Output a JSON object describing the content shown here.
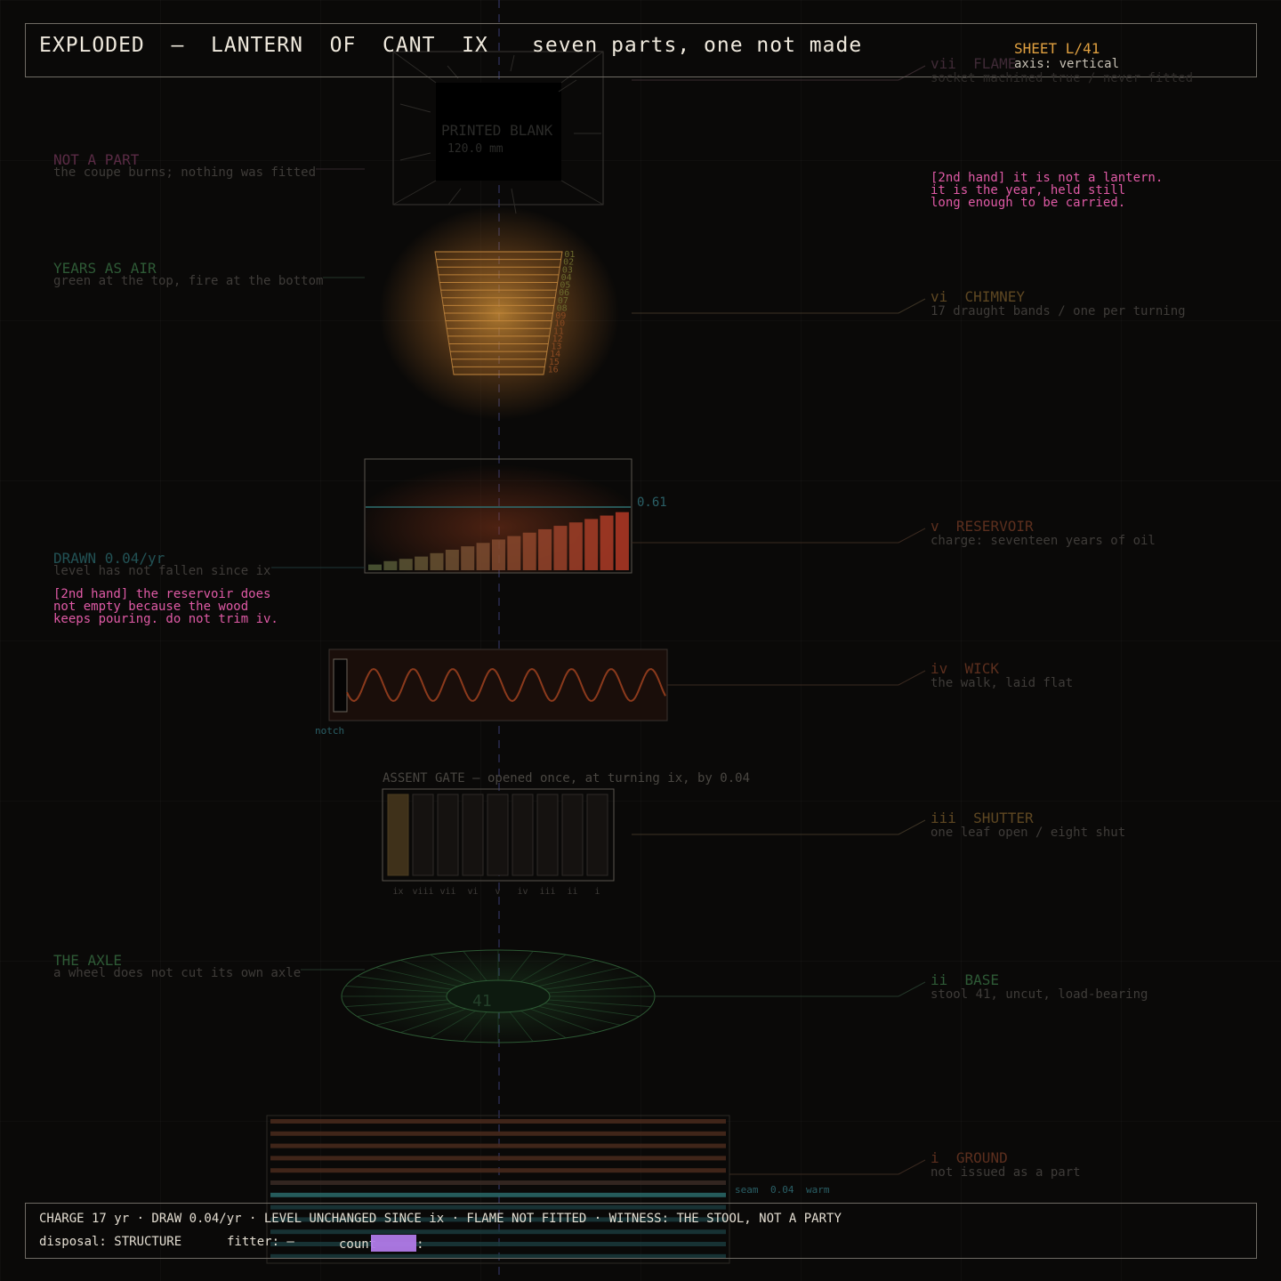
{
  "header": {
    "title": "EXPLODED  —  LANTERN  OF  CANT  IX",
    "subtitle": "seven parts, one not made",
    "sheet": "SHEET L/41",
    "axis": "axis: vertical"
  },
  "colors": {
    "background": "#0a0908",
    "frame": "#6f6b64",
    "amber": "#e0a040",
    "rust": "#b2442a",
    "teal": "#1d7a72",
    "green": "#2d6a36",
    "pink": "#e05aa6",
    "violet": "#b07ae8"
  },
  "parts": {
    "flame": {
      "num": "vii",
      "name": "FLAME",
      "desc": "socket machined true / never fitted"
    },
    "chimney": {
      "num": "vi",
      "name": "CHIMNEY",
      "desc": "17 draught bands / one per turning"
    },
    "reservoir": {
      "num": "v",
      "name": "RESERVOIR",
      "desc": "charge: seventeen years of oil"
    },
    "wick": {
      "num": "iv",
      "name": "WICK",
      "desc": "the walk, laid flat"
    },
    "shutter": {
      "num": "iii",
      "name": "SHUTTER",
      "desc": "one leaf open / eight shut"
    },
    "base": {
      "num": "ii",
      "name": "BASE",
      "desc": "stool 41, uncut, load-bearing"
    },
    "ground": {
      "num": "i",
      "name": "GROUND",
      "desc": "not issued as a part"
    }
  },
  "left_notes": {
    "not_part": {
      "title": "NOT A PART",
      "desc": "the coupe burns; nothing was fitted"
    },
    "years_air": {
      "title": "YEARS AS AIR",
      "desc": "green at the top, fire at the bottom"
    },
    "drawn": {
      "title": "DRAWN 0.04/yr",
      "desc": "level has not fallen since ix"
    },
    "axle": {
      "title": "THE AXLE",
      "desc": "a wheel does not cut its own axle"
    }
  },
  "second_hand": {
    "lantern": [
      "[2nd hand] it is not a lantern.",
      "it is the year, held still",
      "long enough to be carried."
    ],
    "reservoir": [
      "[2nd hand] the reservoir does",
      "not empty because the wood",
      "keeps pouring. do not trim iv."
    ]
  },
  "flame_blank": {
    "label": "PRINTED BLANK",
    "size": "120.0 mm"
  },
  "chimney_bands": [
    "01",
    "02",
    "03",
    "04",
    "05",
    "06",
    "07",
    "08",
    "09",
    "10",
    "11",
    "12",
    "13",
    "14",
    "15",
    "16"
  ],
  "reservoir_level": "0.61",
  "reservoir_bars": [
    0.05,
    0.08,
    0.1,
    0.12,
    0.15,
    0.18,
    0.21,
    0.24,
    0.27,
    0.3,
    0.33,
    0.36,
    0.39,
    0.42,
    0.45,
    0.48,
    0.51
  ],
  "wick_notch": "notch",
  "gate": {
    "title": "ASSENT GATE — opened once, at turning ix, by 0.04",
    "leaves": [
      "ix",
      "viii",
      "vii",
      "vi",
      "v",
      "iv",
      "iii",
      "ii",
      "i"
    ],
    "open_index": 0
  },
  "base_label": "41",
  "seam": {
    "left": "seam",
    "value": "0.04",
    "right": "warm"
  },
  "footer": {
    "line1": "CHARGE 17 yr · DRAW 0.04/yr · LEVEL UNCHANGED SINCE ix · FLAME NOT FITTED · WITNESS: THE STOOL, NOT A PARTY",
    "disposal": "disposal: STRUCTURE",
    "fitter": "fitter: —",
    "count_prefix": "count",
    "count_suffix": ":"
  }
}
